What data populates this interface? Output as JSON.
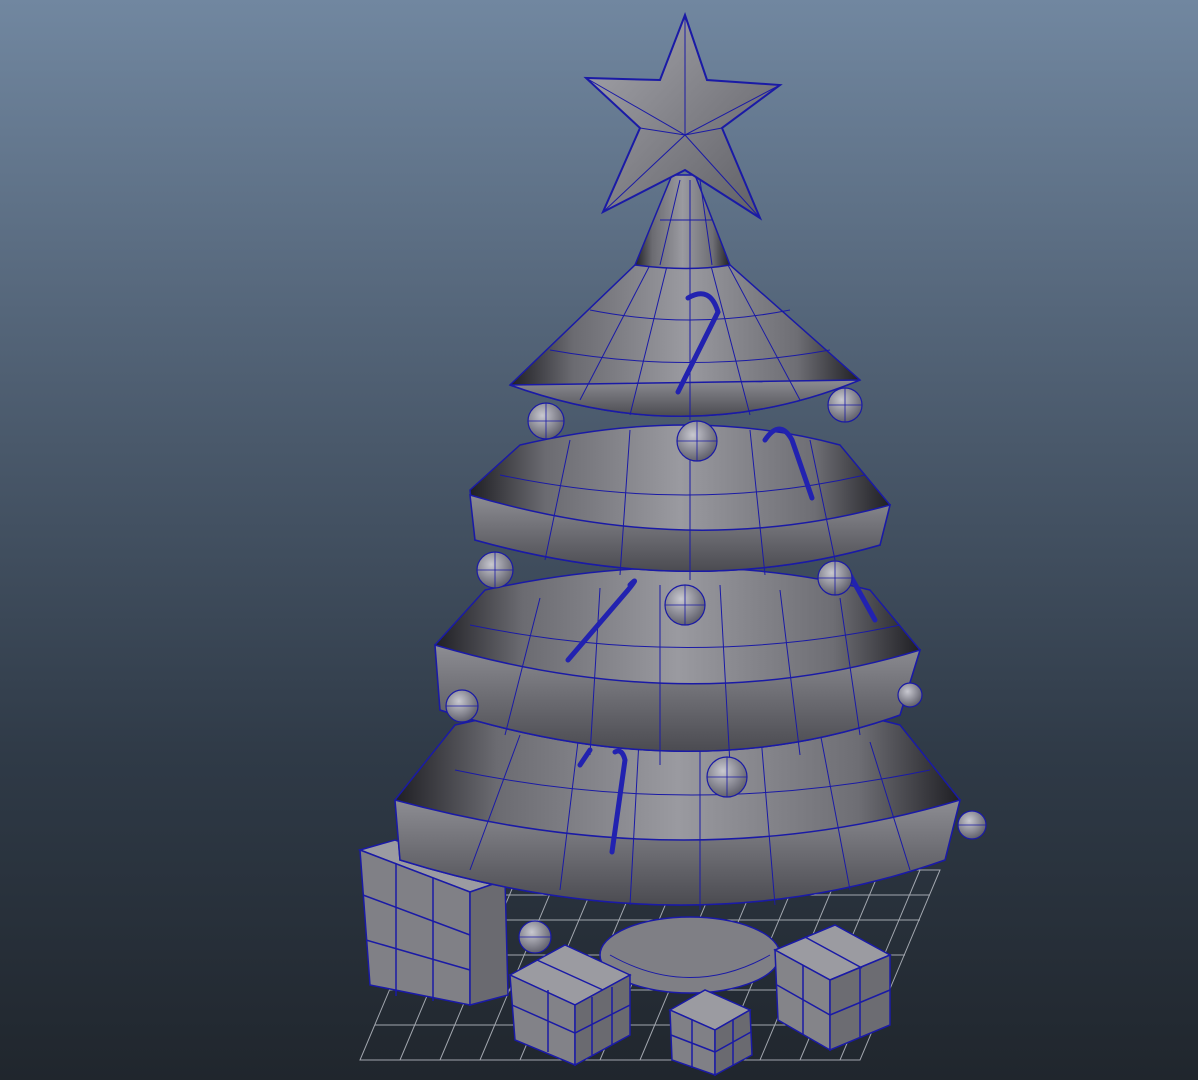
{
  "viewport": {
    "mode": "wireframe-on-shaded",
    "background_top": "#7187a0",
    "background_bottom": "#20262d",
    "wire_color": "#1a1aa6",
    "grid_color": "#b8bcc4",
    "mesh_fill": "#8c8c92"
  },
  "scene": {
    "object": "christmas-tree-model",
    "parts": [
      "star-topper",
      "top-spike",
      "tier-1",
      "tier-2",
      "tier-3",
      "tier-4",
      "trunk",
      "ornament-balls",
      "candy-canes",
      "gift-boxes",
      "ground-grid"
    ]
  }
}
